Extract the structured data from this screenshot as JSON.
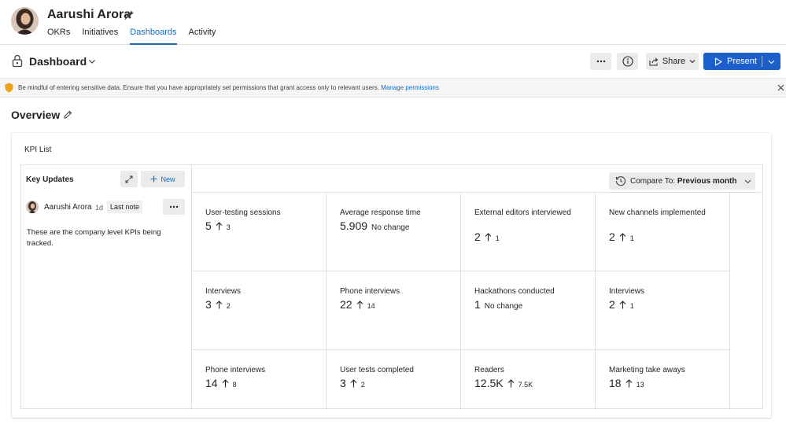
{
  "profile": {
    "name": "Aarushi Arora",
    "tabs": [
      {
        "label": "OKRs",
        "active": false
      },
      {
        "label": "Initiatives",
        "active": false
      },
      {
        "label": "Dashboards",
        "active": true
      },
      {
        "label": "Activity",
        "active": false
      }
    ]
  },
  "toolbar": {
    "title": "Dashboard",
    "more_label": "More options",
    "share_label": "Share",
    "present_label": "Present"
  },
  "banner": {
    "message": "Be mindful of entering sensitive data. Ensure that you have appropriately set permissions that grant access only to relevant users.",
    "link_label": "Manage permissions"
  },
  "overview": {
    "title": "Overview"
  },
  "kpi_list": {
    "title": "KPI List",
    "compare_label": "Compare To:",
    "compare_value": "Previous month"
  },
  "key_updates": {
    "title": "Key Updates",
    "new_label": "New",
    "note": {
      "author": "Aarushi Arora",
      "time": "1d",
      "badge": "Last note",
      "text": "These are the company level KPIs being tracked."
    }
  },
  "kpis": [
    {
      "name": "User-testing sessions",
      "value": "5",
      "delta": "3",
      "status": ""
    },
    {
      "name": "Average response time",
      "value": "5.909",
      "delta": "",
      "status": "No change"
    },
    {
      "name": "External editors interviewed",
      "value": "2",
      "delta": "1",
      "status": ""
    },
    {
      "name": "New channels implemented",
      "value": "2",
      "delta": "1",
      "status": ""
    },
    {
      "name": "Interviews",
      "value": "3",
      "delta": "2",
      "status": ""
    },
    {
      "name": "Phone interviews",
      "value": "22",
      "delta": "14",
      "status": ""
    },
    {
      "name": "Hackathons conducted",
      "value": "1",
      "delta": "",
      "status": "No change"
    },
    {
      "name": "Interviews",
      "value": "2",
      "delta": "1",
      "status": ""
    },
    {
      "name": "Phone interviews",
      "value": "14",
      "delta": "8",
      "status": ""
    },
    {
      "name": "User tests completed",
      "value": "3",
      "delta": "2",
      "status": ""
    },
    {
      "name": "Readers",
      "value": "12.5K",
      "delta": "7.5K",
      "status": ""
    },
    {
      "name": "Marketing take aways",
      "value": "18",
      "delta": "13",
      "status": ""
    }
  ],
  "colors": {
    "accent": "#0f6cbd",
    "present_button": "#1c5fcb",
    "warning_shield": "#e8a317",
    "neutral_button": "#ebebeb"
  }
}
